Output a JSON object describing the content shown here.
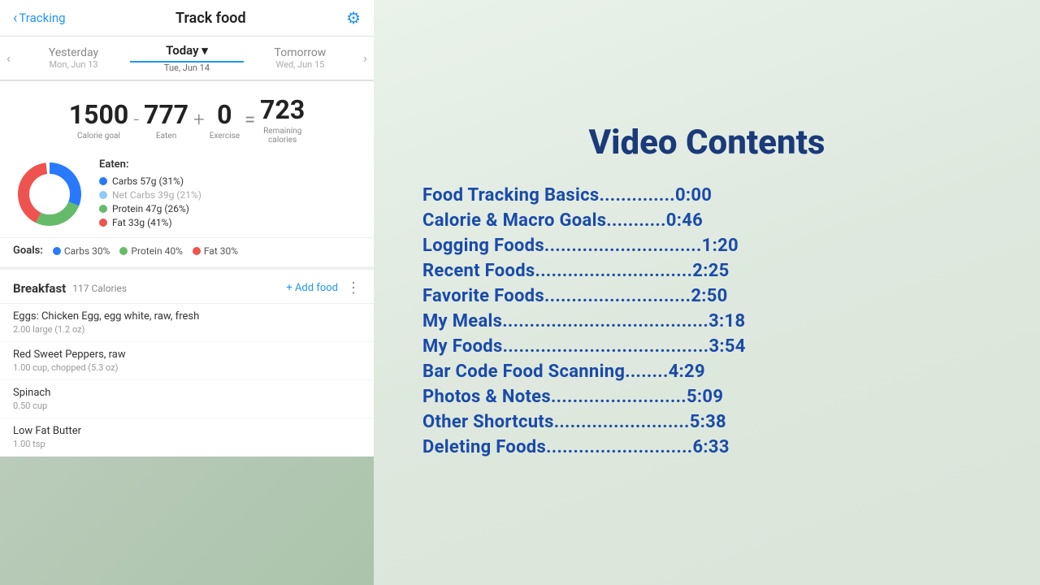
{
  "header": {
    "back_label": "Tracking",
    "title": "Track food",
    "gear_icon": "⚙"
  },
  "date_nav": {
    "prev": {
      "label": "Yesterday",
      "sub": "Mon, Jun 13"
    },
    "current": {
      "label": "Today ▾",
      "sub": "Tue, Jun 14"
    },
    "next": {
      "label": "Tomorrow",
      "sub": "Wed, Jun 15"
    }
  },
  "calories": {
    "goal": "1500",
    "goal_label": "Calorie goal",
    "minus": "-",
    "eaten": "777",
    "eaten_label": "Eaten",
    "plus": "+",
    "exercise": "0",
    "exercise_label": "Exercise",
    "equals": "=",
    "remaining": "723",
    "remaining_label": "Remaining\ncalories"
  },
  "macros": {
    "title": "Eaten:",
    "items": [
      {
        "color": "#2979FF",
        "label": "Carbs 57g (31%)",
        "muted": false
      },
      {
        "color": "#90CAF9",
        "label": "Net Carbs 39g (21%)",
        "muted": true
      },
      {
        "color": "#66BB6A",
        "label": "Protein 47g (26%)",
        "muted": false
      },
      {
        "color": "#EF5350",
        "label": "Fat 33g (41%)",
        "muted": false
      }
    ],
    "donut": {
      "carbs_pct": 31,
      "protein_pct": 26,
      "fat_pct": 41,
      "carbs_color": "#2979FF",
      "protein_color": "#66BB6A",
      "fat_color": "#EF5350"
    }
  },
  "goals": {
    "label": "Goals:",
    "items": [
      {
        "color": "#2979FF",
        "label": "Carbs 30%"
      },
      {
        "color": "#66BB6A",
        "label": "Protein 40%"
      },
      {
        "color": "#EF5350",
        "label": "Fat 30%"
      }
    ]
  },
  "breakfast": {
    "title": "Breakfast",
    "calories": "117 Calories",
    "add_food": "+ Add food",
    "more_icon": "⋮",
    "foods": [
      {
        "name": "Eggs: Chicken Egg, egg white, raw, fresh",
        "detail": "2.00 large (1.2 oz)"
      },
      {
        "name": "Red Sweet Peppers, raw",
        "detail": "1.00 cup, chopped (5.3 oz)"
      },
      {
        "name": "Spinach",
        "detail": "0.50 cup"
      },
      {
        "name": "Low Fat Butter",
        "detail": "1.00 tsp"
      }
    ]
  },
  "video_contents": {
    "title": "Video Contents",
    "items": [
      {
        "label": "Food Tracking Basics..............0:00"
      },
      {
        "label": "Calorie & Macro Goals...........0:46"
      },
      {
        "label": "Logging Foods.............................1:20"
      },
      {
        "label": "Recent Foods.............................2:25"
      },
      {
        "label": "Favorite Foods...........................2:50"
      },
      {
        "label": "My Meals......................................3:18"
      },
      {
        "label": "My Foods......................................3:54"
      },
      {
        "label": "Bar Code Food Scanning........4:29"
      },
      {
        "label": "Photos & Notes.........................5:09"
      },
      {
        "label": "Other Shortcuts.........................5:38"
      },
      {
        "label": "Deleting Foods...........................6:33"
      }
    ]
  }
}
